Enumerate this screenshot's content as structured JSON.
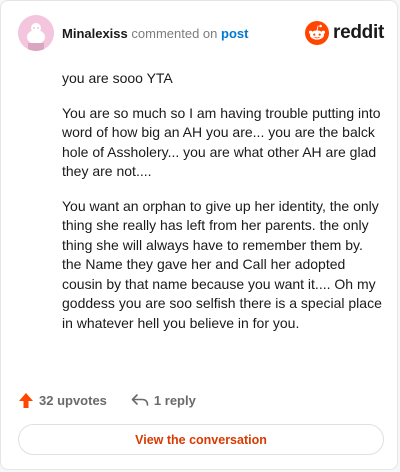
{
  "header": {
    "username": "Minalexiss",
    "commented_text": "commented on",
    "post_link": "post",
    "brand": "reddit"
  },
  "comment": {
    "paragraphs": [
      "you are sooo YTA",
      "You are so much so I am having trouble putting into word of how big an AH you are... you are the balck hole of Assholery... you are what other AH are glad they are not....",
      "You want an orphan to give up her identity, the only thing she really has left from her parents. the only thing she will always have to remember them by. the Name they gave her and Call her adopted cousin by that name because you want it.... Oh my goddess you are soo selfish there is a special place in whatever hell you believe in for you."
    ]
  },
  "actions": {
    "upvotes": "32 upvotes",
    "replies": "1 reply"
  },
  "cta": {
    "label": "View the conversation"
  },
  "colors": {
    "accent": "#d93a00",
    "upvote": "#ff4500",
    "link": "#0079d3"
  }
}
